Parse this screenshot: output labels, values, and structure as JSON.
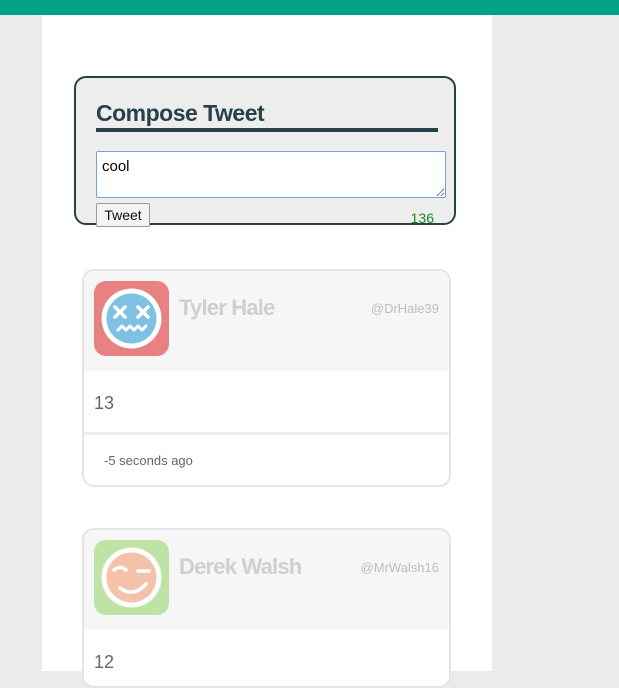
{
  "compose": {
    "title": "Compose Tweet",
    "input_value": "cool",
    "button_label": "Tweet",
    "char_count": "136"
  },
  "tweets": [
    {
      "name": "Tyler Hale",
      "handle": "@DrHale39",
      "text": "13",
      "time": "-5 seconds ago",
      "avatar_icon": "dizzy-face-icon",
      "avatar_bg": "#e88181",
      "avatar_face": "#7ec1e2"
    },
    {
      "name": "Derek Walsh",
      "handle": "@MrWalsh16",
      "text": "12",
      "avatar_icon": "winking-face-icon",
      "avatar_bg": "#bfe3a4",
      "avatar_face": "#f4c2a8"
    }
  ],
  "colors": {
    "topbar": "#00a184",
    "accent_dark": "#27414b",
    "count_green": "#1c8a1c"
  }
}
